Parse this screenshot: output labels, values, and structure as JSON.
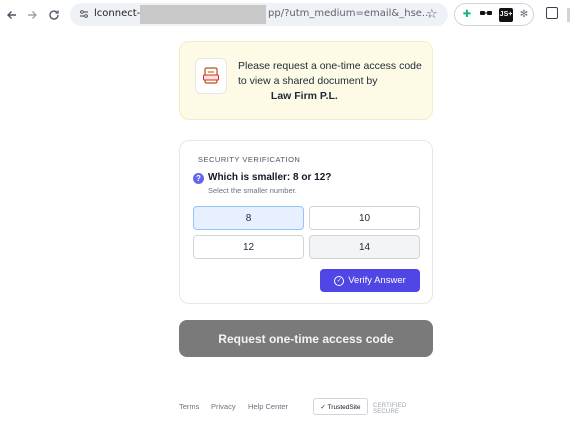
{
  "browser": {
    "url_start": "lconnect-s",
    "url_end": "pp/?utm_medium=email&_hse...",
    "icons": [
      "arrow-left-icon",
      "arrow-right-icon",
      "reload-icon",
      "site-info-icon",
      "star-icon",
      "puzzle-icon"
    ]
  },
  "extensions": {
    "ext3_label": "JS+"
  },
  "banner": {
    "line": "Please request a one-time access code to view a shared document by",
    "firm": "Law Firm P.L."
  },
  "security": {
    "title": "SECURITY VERIFICATION",
    "question": "Which is smaller: 8 or 12?",
    "hint": "Select the smaller number.",
    "options": [
      "8",
      "10",
      "12",
      "14"
    ],
    "verify_label": "Verify Answer",
    "accent": "#5046e5"
  },
  "request_button": {
    "label": "Request one-time access code"
  },
  "footer": {
    "links": [
      "Terms",
      "Privacy",
      "Help Center"
    ],
    "badge": "✓ TrustedSite",
    "certified": "CERTIFIED SECURE"
  }
}
